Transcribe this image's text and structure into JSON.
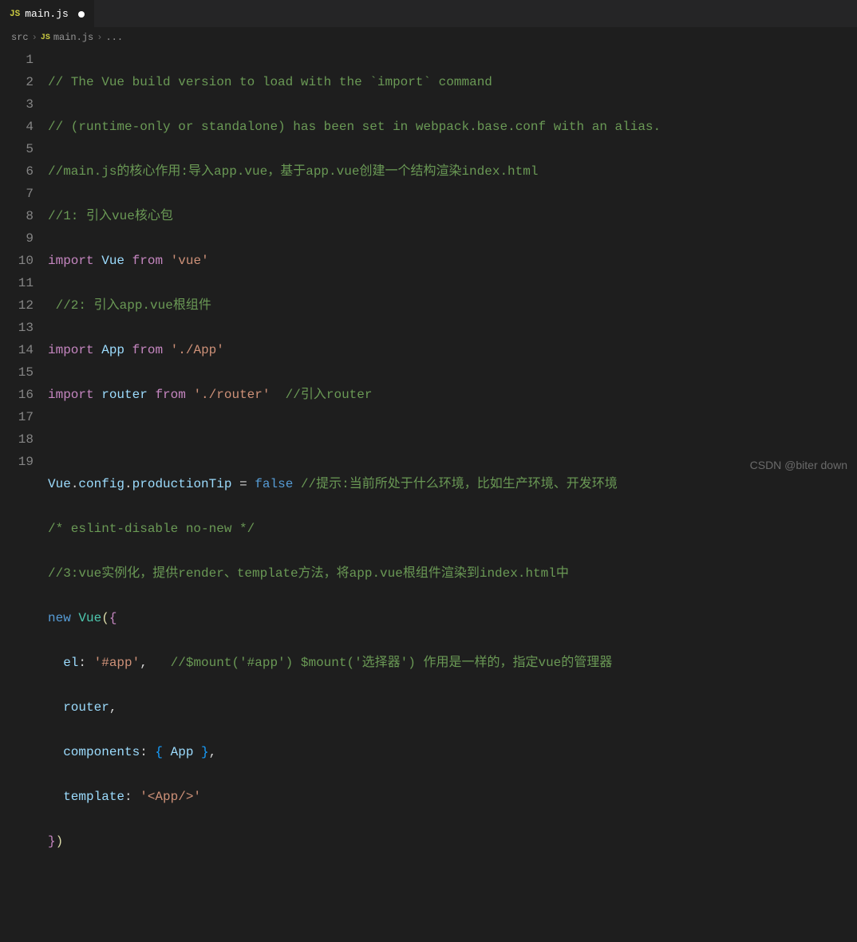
{
  "tab": {
    "icon": "JS",
    "filename": "main.js"
  },
  "breadcrumb": {
    "item1": "src",
    "sep": "›",
    "icon": "JS",
    "item2": "main.js",
    "item3": "..."
  },
  "lines": {
    "n1": "1",
    "n2": "2",
    "n3": "3",
    "n4": "4",
    "n5": "5",
    "n6": "6",
    "n7": "7",
    "n8": "8",
    "n9": "9",
    "n10": "10",
    "n11": "11",
    "n12": "12",
    "n13": "13",
    "n14": "14",
    "n15": "15",
    "n16": "16",
    "n17": "17",
    "n18": "18",
    "n19": "19"
  },
  "code": {
    "l1": "// The Vue build version to load with the `import` command",
    "l2": "// (runtime-only or standalone) has been set in webpack.base.conf with an alias.",
    "l3": "//main.js的核心作用:导入app.vue，基于app.vue创建一个结构渲染index.html",
    "l4": "//1: 引入vue核心包",
    "l5_import": "import",
    "l5_vue": "Vue",
    "l5_from": "from",
    "l5_str": "'vue'",
    "l6": " //2: 引入app.vue根组件",
    "l7_import": "import",
    "l7_app": "App",
    "l7_from": "from",
    "l7_str": "'./App'",
    "l8_import": "import",
    "l8_router": "router",
    "l8_from": "from",
    "l8_str": "'./router'",
    "l8_comment": "  //引入router",
    "l10_vue": "Vue",
    "l10_dot1": ".",
    "l10_config": "config",
    "l10_dot2": ".",
    "l10_prod": "productionTip",
    "l10_eq": " = ",
    "l10_false": "false",
    "l10_comment": " //提示:当前所处于什么环境，比如生产环境、开发环境",
    "l11": "/* eslint-disable no-new */",
    "l12": "//3:vue实例化，提供render、template方法，将app.vue根组件渲染到index.html中",
    "l13_new": "new",
    "l13_vue": "Vue",
    "l13_p1": "(",
    "l13_b1": "{",
    "l14_el": "el",
    "l14_colon": ": ",
    "l14_str": "'#app'",
    "l14_comma": ",",
    "l14_comment": "   //$mount('#app') $mount('选择器') 作用是一样的，指定vue的管理器",
    "l15_router": "router",
    "l15_comma": ",",
    "l16_comp": "components",
    "l16_colon": ": ",
    "l16_b1": "{ ",
    "l16_app": "App",
    "l16_b2": " }",
    "l16_comma": ",",
    "l17_tmpl": "template",
    "l17_colon": ": ",
    "l17_str": "'<App/>'",
    "l18_b": "}",
    "l18_p": ")"
  },
  "watermark": "CSDN @biter down"
}
